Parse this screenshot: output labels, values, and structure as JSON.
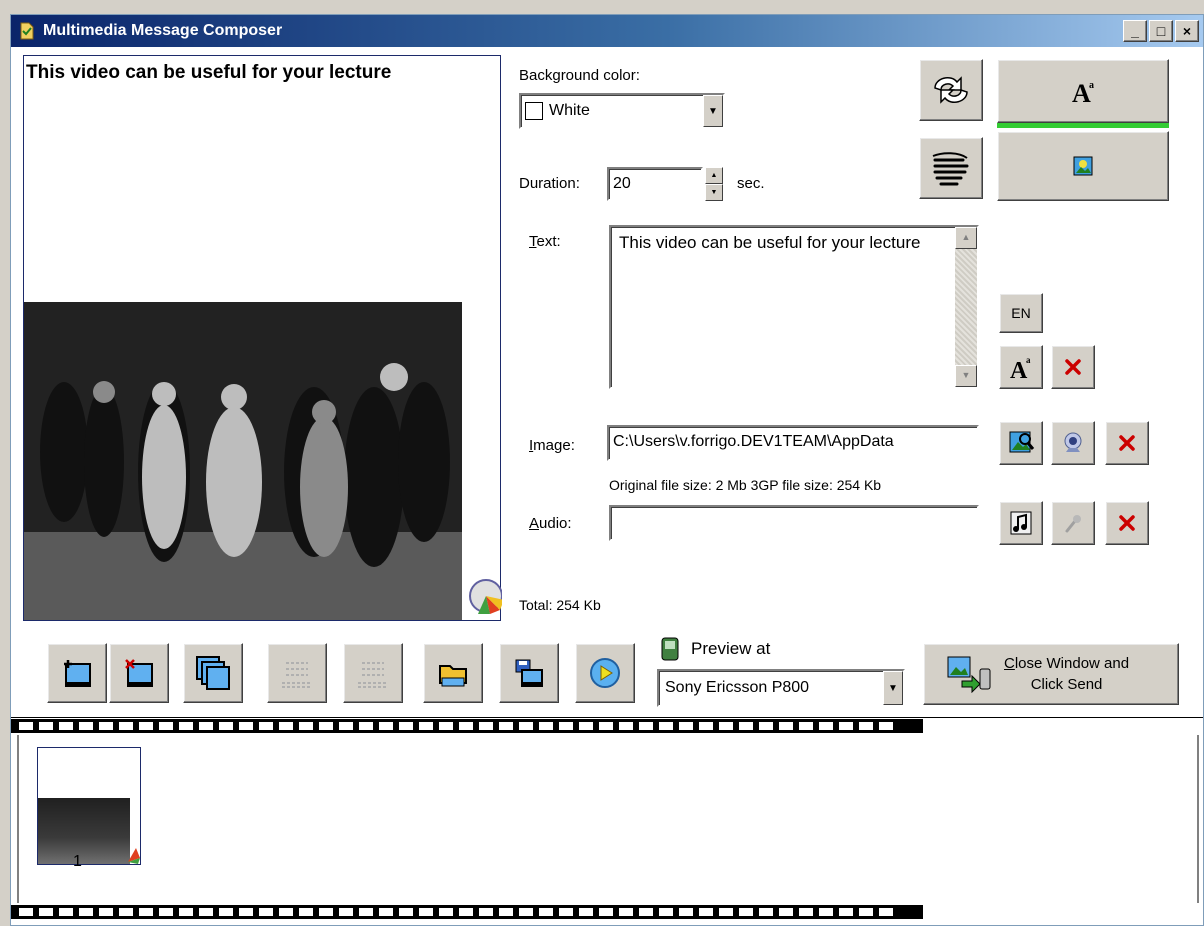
{
  "window": {
    "title": "Multimedia Message Composer",
    "controls": {
      "minimize": "_",
      "maximize": "□",
      "close": "×"
    }
  },
  "preview": {
    "text": "This video can be useful for your lecture"
  },
  "background": {
    "label": "Background color:",
    "value": "White"
  },
  "duration": {
    "label": "Duration:",
    "value": "20",
    "unit": "sec."
  },
  "text_field": {
    "label_first": "T",
    "label_rest": "ext:",
    "value": "This video can be useful for your lecture",
    "lang_button": "EN"
  },
  "image": {
    "label_first": "I",
    "label_rest": "mage:",
    "path": "C:\\Users\\v.forrigo.DEV1TEAM\\AppData",
    "size_info": "Original file size: 2 Mb  3GP file size: 254 Kb"
  },
  "audio": {
    "label_first": "A",
    "label_rest": "udio:",
    "path": ""
  },
  "total": "Total: 254 Kb",
  "preview_at": {
    "label": "Preview at",
    "device": "Sony Ericsson P800"
  },
  "send_button": {
    "line1_first": "C",
    "line1_rest": "lose Window and",
    "line2": "Click Send"
  },
  "slides": [
    {
      "number": "1"
    }
  ],
  "icons": {
    "rotate": "rotate-arrows-icon",
    "hand": "hand-icon",
    "font": "font-icon",
    "image_insert": "image-insert-icon"
  },
  "colors": {
    "accent_green": "#33cc33",
    "delete_red": "#cc0000",
    "title_bar": "#0a246a"
  }
}
